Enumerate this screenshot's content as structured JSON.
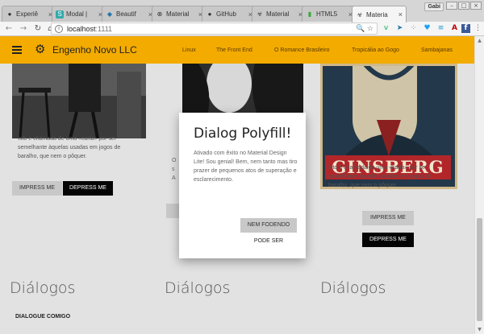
{
  "browser": {
    "tabs": [
      {
        "label": "Experiê",
        "icon": "github-icon"
      },
      {
        "label": "Modal |",
        "icon": "s-icon"
      },
      {
        "label": "Beautif",
        "icon": "code-icon"
      },
      {
        "label": "Material",
        "icon": "material-icon"
      },
      {
        "label": "GitHub",
        "icon": "github-icon"
      },
      {
        "label": "Material",
        "icon": "biohazard-icon"
      },
      {
        "label": "HTML5",
        "icon": "html-icon"
      },
      {
        "label": "Materia",
        "icon": "biohazard-icon"
      }
    ],
    "user": "Gabi",
    "url_host": "localhost",
    "url_port": ":1111"
  },
  "app": {
    "brand": "Engenho Novo LLC",
    "nav": [
      "Linux",
      "The Front End",
      "O Romance Brasileiro",
      "Tropicália ao Gogo",
      "Sambajanas"
    ],
    "colors": {
      "appbar": "#f3ab00",
      "dark_button": "#050505"
    }
  },
  "content": {
    "card1_text": [
      "Isto é chamada de uma «carta» por ser",
      "semelhante àquelas usadas em jogos de",
      "baralho, que nem o pôquer."
    ],
    "card3_text": [
      "Isto é chamada de uma «carta» por ser",
      "semelhante àquelas usadas em jogos de",
      "baralho, que nem o pôquer."
    ],
    "poster_text": "GINSBERG",
    "impress_label": "IMPRESS ME",
    "depress_label": "DEPRESS ME",
    "section_title": "Diálogos",
    "dialogue_link": "DIALOGUE COMIGO"
  },
  "dialog": {
    "title": "Dialog Polyfill!",
    "body": "Ativado com êxito no Material Design Lite! Sou genial! Bem, nem tanto mas tiro prazer de pequenos atos de superação e esclarecimento.",
    "button_no": "NEM FODENDO",
    "button_yes": "PODE SER"
  }
}
